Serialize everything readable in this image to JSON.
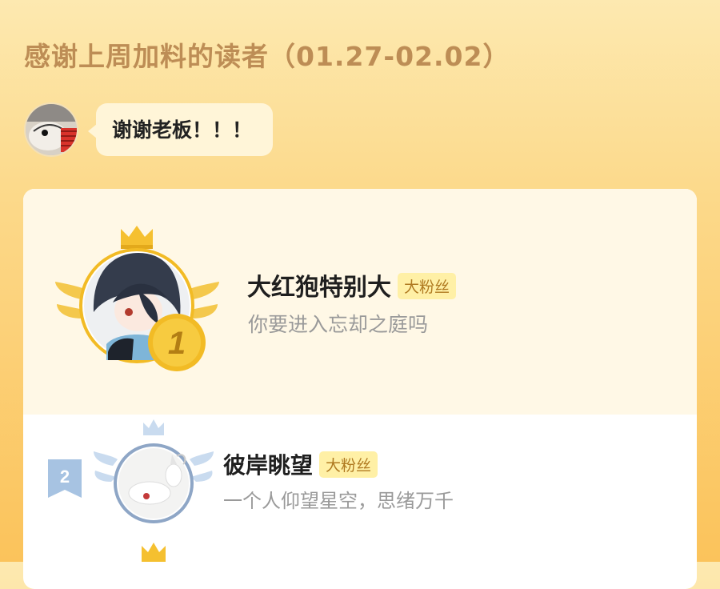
{
  "header": {
    "title": "感谢上周加料的读者（01.27-02.02）"
  },
  "author_message": {
    "text": "谢谢老板！！！"
  },
  "leaderboard": {
    "entries": [
      {
        "rank": "1",
        "name": "大红狍特别大",
        "badge": "大粉丝",
        "motto": "你要进入忘却之庭吗"
      },
      {
        "rank": "2",
        "name": "彼岸眺望",
        "badge": "大粉丝",
        "motto": "一个人仰望星空，思绪万千"
      }
    ]
  },
  "colors": {
    "background_top": "#fde9b0",
    "background_bottom": "#fbc35b",
    "title": "#bd8d55",
    "gold": "#f2bb25",
    "badge_bg": "#fff0a6",
    "badge_text": "#b07a21",
    "silver": "#a7c3e2"
  },
  "icons": [
    "author-avatar",
    "crown-icon",
    "laurel-wings-icon",
    "rank-medal-icon",
    "rank-flag-icon"
  ]
}
